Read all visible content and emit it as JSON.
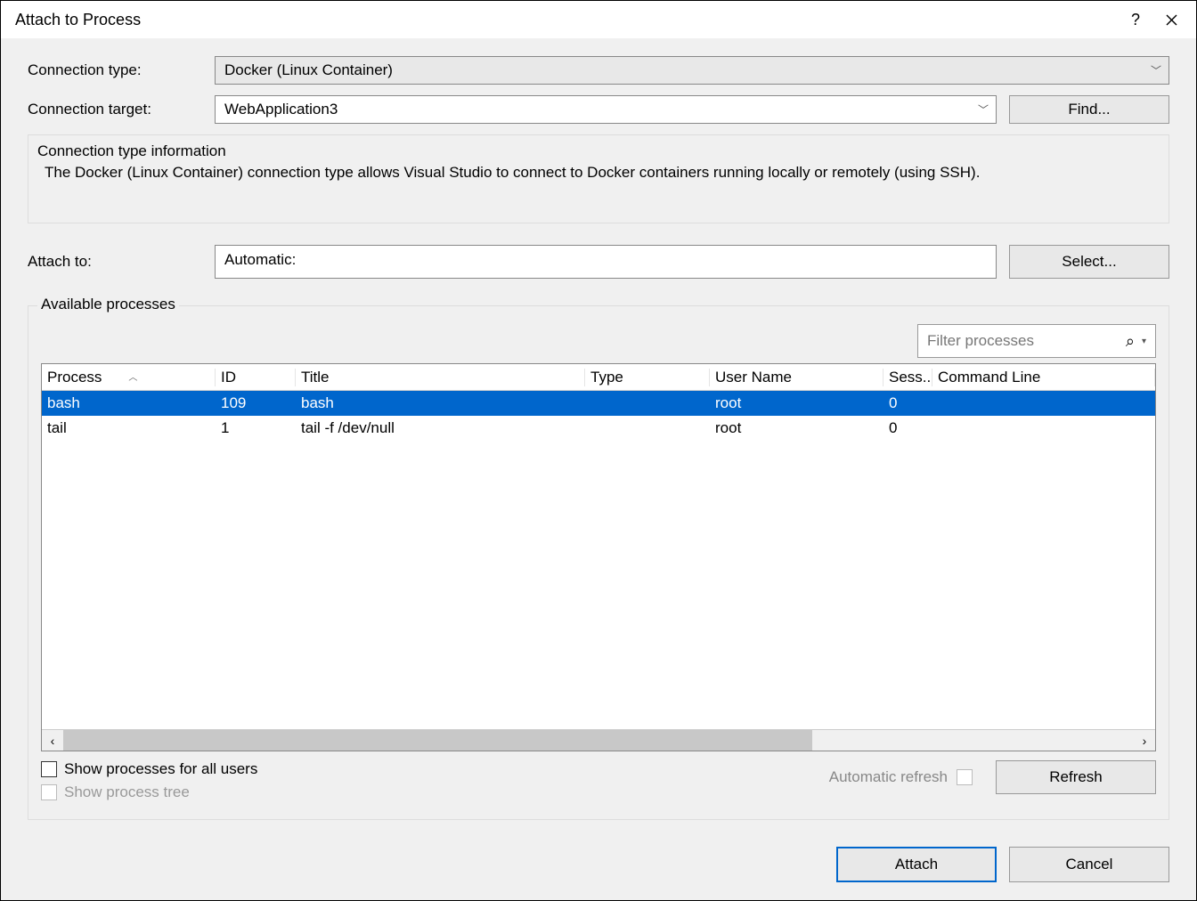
{
  "title": "Attach to Process",
  "labels": {
    "connection_type": "Connection type:",
    "connection_target": "Connection target:",
    "attach_to": "Attach to:",
    "available_processes": "Available processes",
    "connection_info_title": "Connection type information",
    "show_all_users": "Show processes for all users",
    "show_process_tree": "Show process tree",
    "automatic_refresh": "Automatic refresh"
  },
  "values": {
    "connection_type": "Docker (Linux Container)",
    "connection_target": "WebApplication3",
    "attach_to": "Automatic:",
    "filter_placeholder": "Filter processes"
  },
  "buttons": {
    "find": "Find...",
    "select": "Select...",
    "refresh": "Refresh",
    "attach": "Attach",
    "cancel": "Cancel"
  },
  "info_text": "The Docker (Linux Container) connection type allows Visual Studio to connect to Docker containers running locally or remotely (using SSH).",
  "columns": {
    "process": "Process",
    "id": "ID",
    "title": "Title",
    "type": "Type",
    "user": "User Name",
    "session": "Sess...",
    "cmd": "Command Line"
  },
  "rows": [
    {
      "process": "bash",
      "id": "109",
      "title": "bash",
      "type": "",
      "user": "root",
      "session": "0",
      "cmd": "",
      "selected": true
    },
    {
      "process": "tail",
      "id": "1",
      "title": "tail -f /dev/null",
      "type": "",
      "user": "root",
      "session": "0",
      "cmd": "",
      "selected": false
    }
  ]
}
